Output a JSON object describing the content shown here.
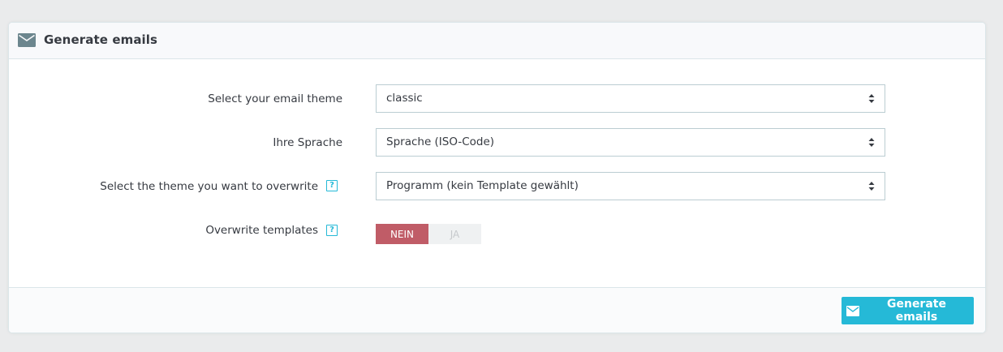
{
  "panel": {
    "title": "Generate emails",
    "header_icon": "envelope-icon"
  },
  "form": {
    "email_theme": {
      "label": "Select your email theme",
      "value": "classic"
    },
    "language": {
      "label": "Ihre Sprache",
      "value": "Sprache (ISO-Code)"
    },
    "overwrite_theme": {
      "label": "Select the theme you want to overwrite",
      "value": "Programm (kein Template gewählt)",
      "help": "?"
    },
    "overwrite_templates": {
      "label": "Overwrite templates",
      "help": "?",
      "option_no": "NEIN",
      "option_yes": "JA",
      "selected": "NEIN"
    }
  },
  "footer": {
    "submit_label": "Generate emails",
    "submit_icon": "envelope-icon"
  },
  "colors": {
    "accent": "#25b9d7",
    "switch_active": "#c05c67"
  }
}
